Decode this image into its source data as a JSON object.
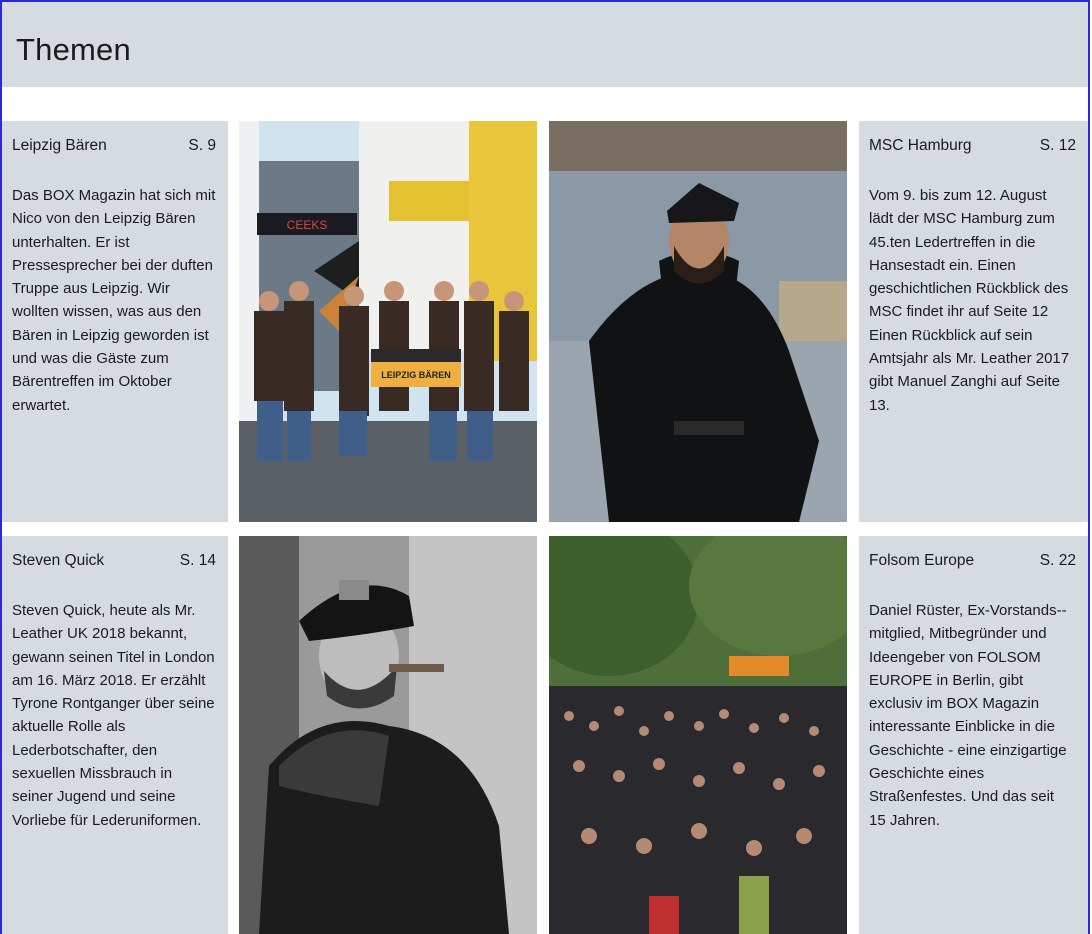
{
  "header": {
    "title": "Themen"
  },
  "articles": [
    {
      "title": "Leipzig Bären",
      "page": "S. 9",
      "body": "Das BOX Magazin hat sich mit Nico von den Leipzig Bären unterhalten. Er ist Pressesprecher bei der duften Truppe aus Leipzig. Wir wollten wissen, was aus den Bären in Leipzig geworden ist und was die Gäste zum Bärentreffen im Oktober erwartet."
    },
    {
      "title": "MSC Hamburg",
      "page": "S. 12",
      "body": "Vom 9. bis zum 12. August lädt der MSC Hamburg zum 45.ten Ledertreffen in die Hansestadt ein. Einen geschichtlichen Rückblick des MSC findet ihr auf Seite 12 Einen Rückblick auf sein Amtsjahr als Mr. Leather 2017 gibt Manuel Zanghi auf Seite 13."
    },
    {
      "title": "Steven Quick",
      "page": "S. 14",
      "body": "Steven Quick, heute als Mr. Leather UK 2018 bekannt, gewann seinen Titel in London am 16. März 2018. Er erzählt Tyrone Rontganger über seine aktuelle Rolle als Lederbotschafter, den sexuellen Missbrauch in seiner Jugend und seine Vorliebe für Lederuniformen."
    },
    {
      "title": "Folsom Europe",
      "page": "S. 22",
      "body": "Daniel Rüster, Ex-Vorstands--mitglied, Mitbegründer und Ideengeber von FOLSOM EUROPE in Berlin, gibt exclusiv im BOX Magazin interessante Einblicke in die Geschichte - eine einzigartige Geschichte eines Straßenfestes. Und das seit 15 Jahren."
    }
  ],
  "photos": {
    "leipzig_banner": "LEIPZIG BÄREN",
    "leipzig_sign": "CEEKS"
  },
  "colors": {
    "panel_bg": "#d5dbe0",
    "frame_border": "#2a2ad0"
  }
}
